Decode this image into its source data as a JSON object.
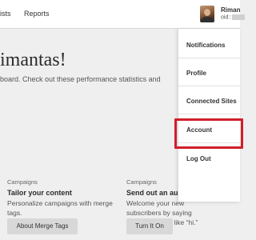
{
  "nav": {
    "items": [
      {
        "label": "ists"
      },
      {
        "label": "Reports"
      }
    ]
  },
  "user": {
    "name": "Riman",
    "id_label": "oid::"
  },
  "main": {
    "greeting": "imantas!",
    "intro": "board. Check out these performance statistics and"
  },
  "cards": [
    {
      "kicker": "Campaigns",
      "title": "Tailor your content",
      "description": "Personalize campaigns with merge tags.",
      "button": "About Merge Tags"
    },
    {
      "kicker": "Campaigns",
      "title": "Send out an au",
      "description": "Welcome your new subscribers by saying something nice like “hi.”",
      "button": "Turn It On"
    }
  ],
  "dropdown": {
    "items": [
      {
        "label": "Notifications"
      },
      {
        "label": "Profile"
      },
      {
        "label": "Connected Sites"
      },
      {
        "label": "Account"
      },
      {
        "label": "Log Out"
      }
    ],
    "highlight_color": "#d11f2a"
  }
}
